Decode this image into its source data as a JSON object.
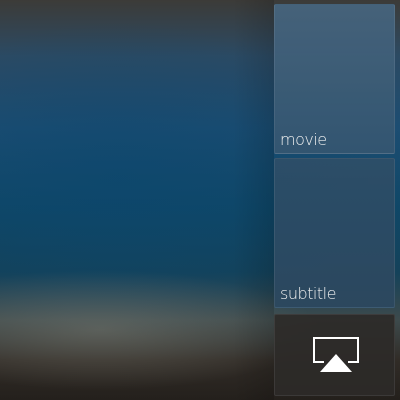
{
  "menu": {
    "movie_label": "movie",
    "subtitle_label": "subtitle",
    "airplay_icon": "airplay-icon"
  },
  "colors": {
    "tile_blue": "#46647d",
    "tile_dark": "#2d2a28",
    "label_text": "#f2f2f2"
  }
}
